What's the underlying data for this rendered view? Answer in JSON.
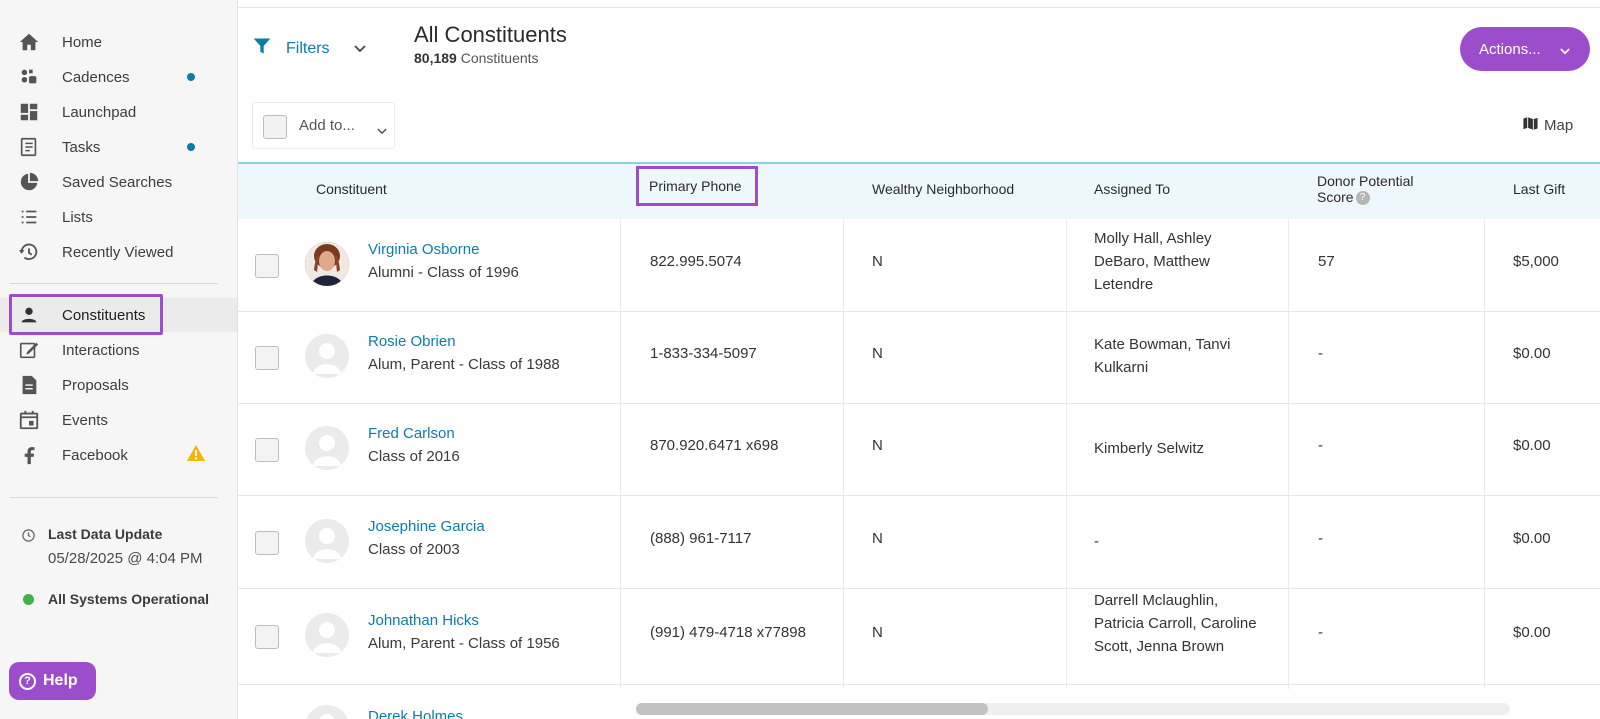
{
  "sidebar": {
    "items": [
      {
        "label": "Home",
        "icon": "home-icon"
      },
      {
        "label": "Cadences",
        "icon": "cadences-icon",
        "dot": true
      },
      {
        "label": "Launchpad",
        "icon": "launchpad-icon"
      },
      {
        "label": "Tasks",
        "icon": "tasks-icon",
        "dot": true
      },
      {
        "label": "Saved Searches",
        "icon": "pie-chart-icon"
      },
      {
        "label": "Lists",
        "icon": "list-icon"
      },
      {
        "label": "Recently Viewed",
        "icon": "history-icon"
      },
      {
        "label": "Constituents",
        "icon": "person-icon",
        "active": true
      },
      {
        "label": "Interactions",
        "icon": "edit-icon"
      },
      {
        "label": "Proposals",
        "icon": "document-icon"
      },
      {
        "label": "Events",
        "icon": "calendar-icon"
      },
      {
        "label": "Facebook",
        "icon": "facebook-icon",
        "warning": true
      }
    ],
    "last_update_title": "Last Data Update",
    "last_update_value": "05/28/2025 @ 4:04 PM",
    "systems_status": "All Systems Operational",
    "help_label": "Help"
  },
  "header": {
    "filters_label": "Filters",
    "title": "All Constituents",
    "count_number": "80,189",
    "count_label": "Constituents",
    "actions_label": "Actions...",
    "add_to_label": "Add to...",
    "map_label": "Map"
  },
  "table": {
    "columns": {
      "constituent": "Constituent",
      "primary_phone": "Primary Phone",
      "wealthy": "Wealthy Neighborhood",
      "assigned": "Assigned To",
      "donor_line1": "Donor Potential",
      "donor_line2": "Score",
      "last_gift": "Last Gift"
    },
    "rows": [
      {
        "name": "Virginia Osborne",
        "sub": "Alumni - Class of 1996",
        "phone": "822.995.5074",
        "wealthy": "N",
        "assigned": "Molly Hall, Ashley DeBaro, Matthew Letendre",
        "score": "57",
        "last_gift": "$5,000"
      },
      {
        "name": "Rosie Obrien",
        "sub": "Alum, Parent - Class of 1988",
        "phone": "1-833-334-5097",
        "wealthy": "N",
        "assigned": "Kate Bowman, Tanvi Kulkarni",
        "score": "-",
        "last_gift": "$0.00"
      },
      {
        "name": "Fred Carlson",
        "sub": "Class of 2016",
        "phone": "870.920.6471 x698",
        "wealthy": "N",
        "assigned": "Kimberly Selwitz",
        "score": "-",
        "last_gift": "$0.00"
      },
      {
        "name": "Josephine Garcia",
        "sub": "Class of 2003",
        "phone": "(888) 961-7117",
        "wealthy": "N",
        "assigned": "-",
        "score": "-",
        "last_gift": "$0.00"
      },
      {
        "name": "Johnathan Hicks",
        "sub": "Alum, Parent - Class of 1956",
        "phone": "(991) 479-4718 x77898",
        "wealthy": "N",
        "assigned": "Darrell Mclaughlin, Patricia Carroll, Caroline Scott, Jenna Brown",
        "score": "-",
        "last_gift": "$0.00"
      },
      {
        "name": "Derek Holmes",
        "sub": "",
        "phone": "",
        "wealthy": "",
        "assigned": "",
        "score": "",
        "last_gift": ""
      }
    ]
  },
  "colors": {
    "accent": "#9c4dcc",
    "link": "#0b7da8",
    "header_bg": "#eef7fb",
    "status_ok": "#43b049",
    "warning": "#f2b705"
  }
}
